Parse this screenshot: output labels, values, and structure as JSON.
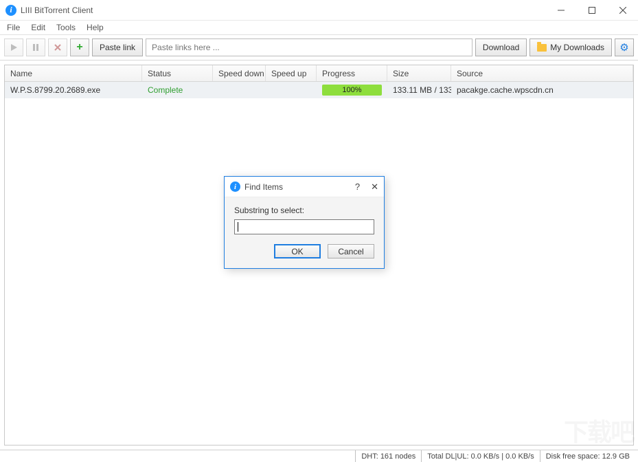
{
  "window": {
    "title": "LIII BitTorrent Client",
    "icon_glyph": "i"
  },
  "menu": {
    "file": "File",
    "edit": "Edit",
    "tools": "Tools",
    "help": "Help"
  },
  "toolbar": {
    "paste_link_label": "Paste link",
    "link_placeholder": "Paste links here ...",
    "download_label": "Download",
    "my_downloads_label": "My Downloads"
  },
  "columns": {
    "name": "Name",
    "status": "Status",
    "speed_down": "Speed down",
    "speed_up": "Speed up",
    "progress": "Progress",
    "size": "Size",
    "source": "Source"
  },
  "rows": [
    {
      "name": "W.P.S.8799.20.2689.exe",
      "status": "Complete",
      "speed_down": "",
      "speed_up": "",
      "progress_text": "100%",
      "size": "133.11 MB / 133...",
      "source": "pacakge.cache.wpscdn.cn"
    }
  ],
  "statusbar": {
    "dht": "DHT: 161 nodes",
    "throughput": "Total DL|UL: 0.0 KB/s | 0.0 KB/s",
    "disk": "Disk free space: 12.9 GB"
  },
  "dialog": {
    "title": "Find Items",
    "label": "Substring to select:",
    "input_value": "",
    "ok": "OK",
    "cancel": "Cancel"
  },
  "watermark": "下载吧"
}
